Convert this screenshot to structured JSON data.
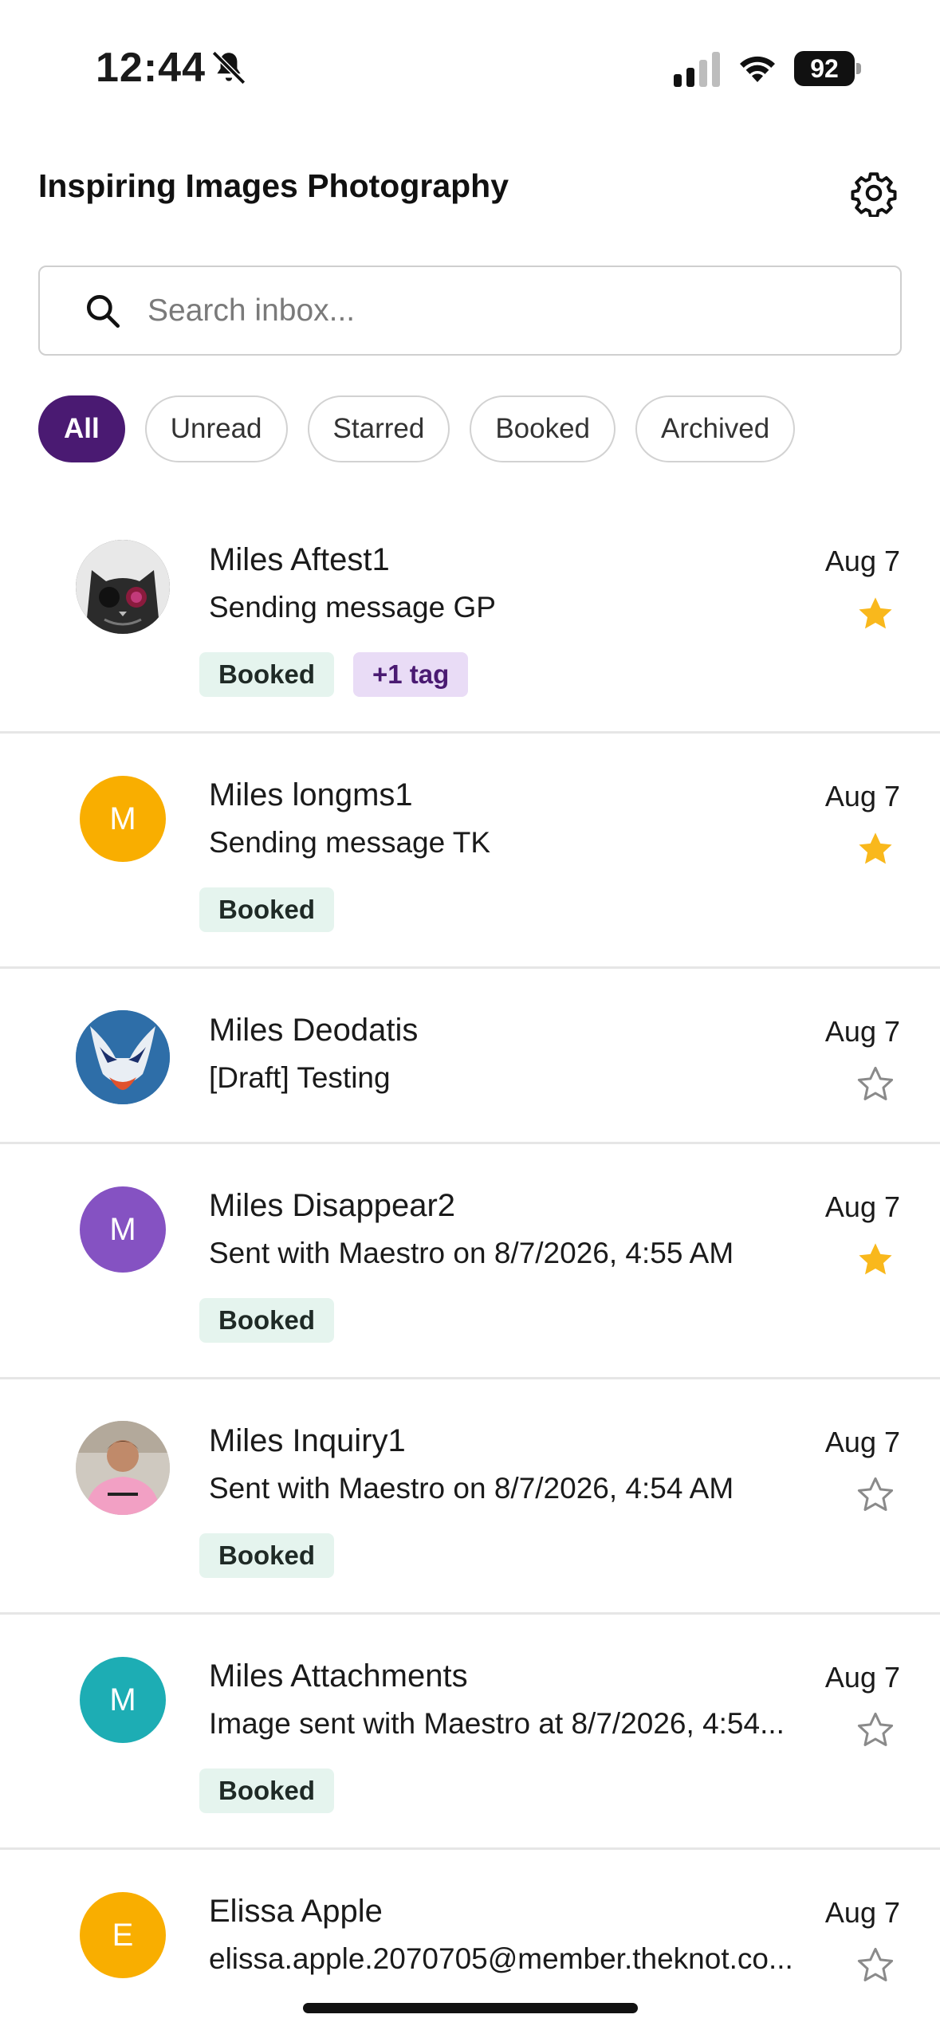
{
  "status_bar": {
    "time": "12:44",
    "battery": "92"
  },
  "header": {
    "title": "Inspiring Images Photography"
  },
  "search": {
    "placeholder": "Search inbox..."
  },
  "filters": [
    "All",
    "Unread",
    "Starred",
    "Booked",
    "Archived"
  ],
  "active_filter": "All",
  "conversations": [
    {
      "name": "Miles Aftest1",
      "preview": "Sending message GP",
      "date": "Aug 7",
      "starred": true,
      "tags": [
        "Booked",
        "+1 tag"
      ],
      "avatar": {
        "type": "photo",
        "subject": "cat with sunglasses"
      }
    },
    {
      "name": "Miles longms1",
      "preview": "Sending message TK",
      "date": "Aug 7",
      "starred": true,
      "tags": [
        "Booked"
      ],
      "avatar": {
        "type": "initial",
        "letter": "M",
        "color": "#F9AE00"
      }
    },
    {
      "name": "Miles Deodatis",
      "preview": "[Draft] Testing",
      "date": "Aug 7",
      "starred": false,
      "tags": [],
      "avatar": {
        "type": "photo",
        "subject": "cartoon creature"
      }
    },
    {
      "name": "Miles Disappear2",
      "preview": "Sent with Maestro on 8/7/2026, 4:55 AM",
      "date": "Aug 7",
      "starred": true,
      "tags": [
        "Booked"
      ],
      "avatar": {
        "type": "initial",
        "letter": "M",
        "color": "#8552C2"
      }
    },
    {
      "name": "Miles Inquiry1",
      "preview": "Sent with Maestro on 8/7/2026, 4:54 AM",
      "date": "Aug 7",
      "starred": false,
      "tags": [
        "Booked"
      ],
      "avatar": {
        "type": "photo",
        "subject": "person in pink jersey"
      }
    },
    {
      "name": "Miles Attachments",
      "preview": "Image sent with Maestro at 8/7/2026, 4:54...",
      "date": "Aug 7",
      "starred": false,
      "tags": [
        "Booked"
      ],
      "avatar": {
        "type": "initial",
        "letter": "M",
        "color": "#1DADB4"
      }
    },
    {
      "name": "Elissa Apple",
      "preview": "elissa.apple.2070705@member.theknot.co...",
      "date": "Aug 7",
      "starred": false,
      "tags": [],
      "avatar": {
        "type": "initial",
        "letter": "E",
        "color": "#F9AE00"
      }
    }
  ],
  "colors": {
    "accent": "#4A1A72",
    "star": "#F9B81C",
    "booked_tag_bg": "#E5F4EE",
    "more_tag_bg": "#E9DCF6"
  },
  "icons": {
    "settings": "gear-icon",
    "search": "search-icon",
    "star": "star-icon",
    "bell": "bell-slash-icon"
  }
}
